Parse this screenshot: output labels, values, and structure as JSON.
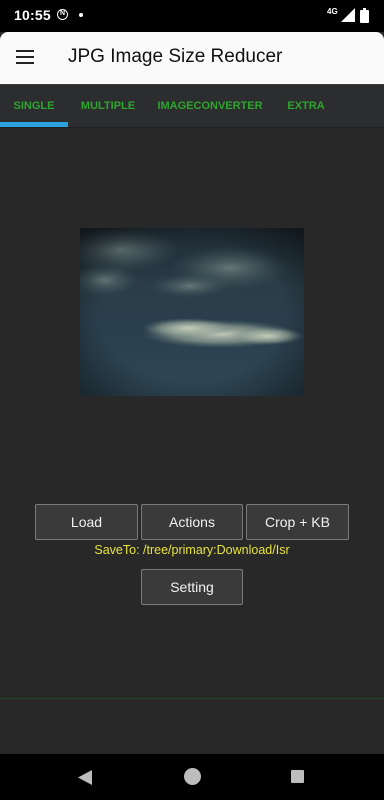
{
  "status_bar": {
    "time": "10:55",
    "notification_badge": "N",
    "network_type": "4G"
  },
  "app_bar": {
    "title": "JPG Image Size Reducer",
    "menu_icon": "hamburger-menu-icon"
  },
  "tabs": [
    {
      "label": "SINGLE",
      "selected": true
    },
    {
      "label": "MULTIPLE",
      "selected": false
    },
    {
      "label": "IMAGECONVERTER",
      "selected": false
    },
    {
      "label": "EXTRA",
      "selected": false
    }
  ],
  "buttons": {
    "load": "Load",
    "actions": "Actions",
    "crop_kb": "Crop + KB",
    "setting": "Setting"
  },
  "save_to": "SaveTo: /tree/primary:Download/Isr",
  "colors": {
    "tab_text": "#2ea52e",
    "tab_indicator": "#2ba2de",
    "save_to_text": "#e8e33c",
    "background": "#282828"
  },
  "nav_bar": {
    "back_icon": "back-triangle-icon",
    "home_icon": "home-circle-icon",
    "recents_icon": "recents-square-icon"
  }
}
